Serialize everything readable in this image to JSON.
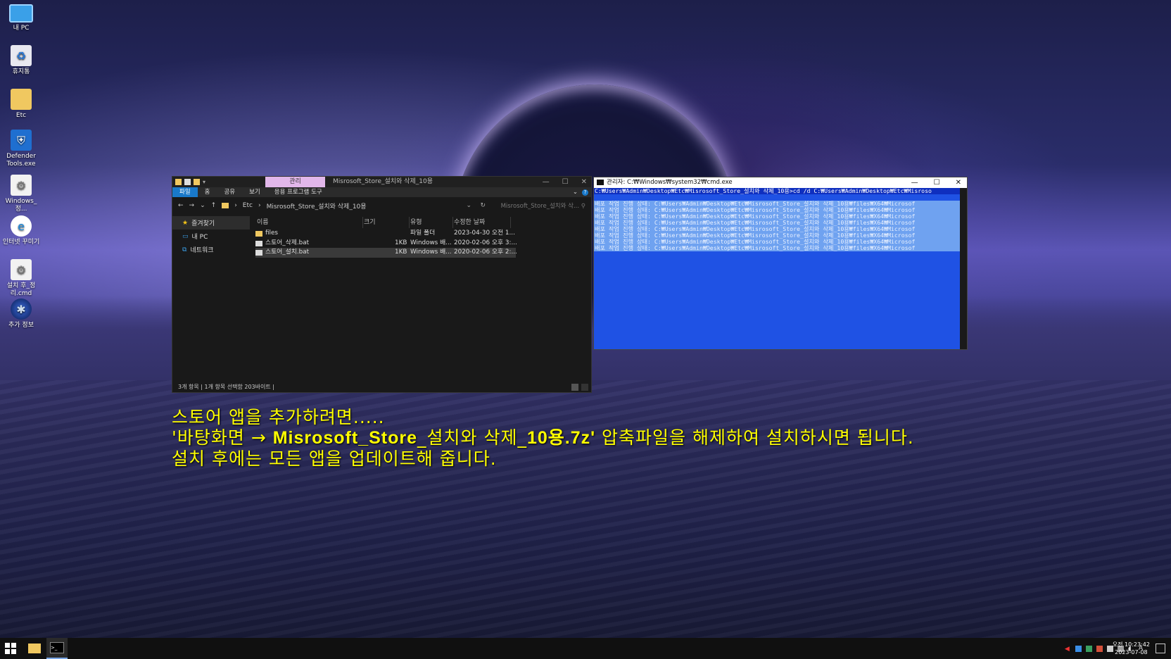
{
  "desktop": {
    "icons": [
      {
        "label": "내 PC",
        "icon": "monitor-icon"
      },
      {
        "label": "휴지통",
        "icon": "recycle-bin-icon"
      },
      {
        "label": "Etc",
        "icon": "folder-icon"
      },
      {
        "label": "Defender Tools.exe",
        "icon": "shield-icon"
      },
      {
        "label": "Windows_정...",
        "icon": "gear-script-icon"
      },
      {
        "label": "인터넷 꾸미기",
        "icon": "internet-explorer-icon"
      },
      {
        "label": "설치 후_정리.cmd",
        "icon": "gear-script-icon"
      },
      {
        "label": "추가 정보",
        "icon": "globe-icon"
      }
    ]
  },
  "explorer": {
    "manage_tab": "관리",
    "title": "Misrosoft_Store_설치와 삭제_10용",
    "ribbon_tabs": [
      "파일",
      "홈",
      "공유",
      "보기",
      "응용 프로그램 도구"
    ],
    "breadcrumb": [
      "Etc",
      "Misrosoft_Store_설치와 삭제_10용"
    ],
    "search_placeholder": "Misrosoft_Store_설치와 삭...",
    "nav": [
      "즐겨찾기",
      "내 PC",
      "네트워크"
    ],
    "columns": [
      "이름",
      "크기",
      "유형",
      "수정한 날짜"
    ],
    "files": [
      {
        "name": "files",
        "size": "",
        "type": "파일 폴더",
        "date": "2023-04-30 오전 1..."
      },
      {
        "name": "스토어_삭제.bat",
        "size": "1KB",
        "type": "Windows 배...",
        "date": "2020-02-06 오후 3:..."
      },
      {
        "name": "스토어_설치.bat",
        "size": "1KB",
        "type": "Windows 배...",
        "date": "2020-02-06 오후 2:..."
      }
    ],
    "status": "3개 항목  |  1개 항목 선택함 203바이트  |"
  },
  "cmd": {
    "title": "관리자: C:₩Windows₩system32₩cmd.exe",
    "command_line": "C:₩Users₩Admin₩Desktop₩Etc₩Misrosoft_Store_설치와 삭제_10용>cd /d C:₩Users₩Admin₩Desktop₩Etc₩Misroso",
    "progress_line": "배포 작업 진행 상태: C:₩Users₩Admin₩Desktop₩Etc₩Misrosoft_Store_설치와 삭제_10용₩files₩X64₩Microsof",
    "progress_count": 8
  },
  "overlay": {
    "line1": "스토어 앱을 추가하려면.....",
    "line2_pre": "'바탕화면 → ",
    "line2_bold": "Misrosoft_Store",
    "line2_mid": "_설치와 삭제_",
    "line2_bold2": "10용.7z'",
    "line2_post": " 압축파일을 해제하여 설치하시면 됩니다.",
    "line3": "설치 후에는 모든 앱을 업데이트해 줍니다."
  },
  "taskbar": {
    "time": "오전 10:23:42",
    "date": "2023-07-08",
    "ime": "A"
  }
}
